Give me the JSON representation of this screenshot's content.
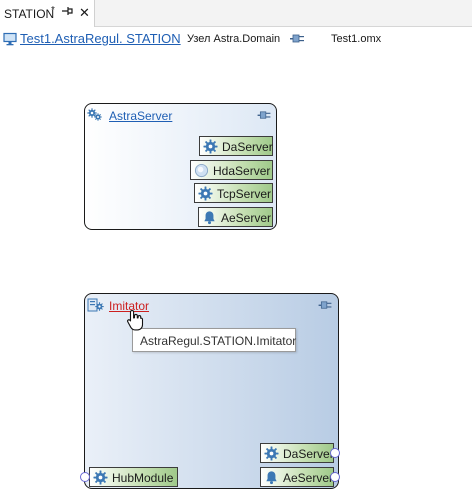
{
  "tab": {
    "title": "STATION",
    "modified": "*",
    "pin_icon": "pin-icon",
    "close_icon": "close-icon"
  },
  "pathbar": {
    "station_icon": "monitor-icon",
    "station_link": "Test1.AstraRegul. STATION",
    "node_text": "Узел Astra.Domain",
    "network_icon": "network-icon",
    "file": "Test1.omx"
  },
  "blocks": [
    {
      "title": "AstraServer",
      "icon": "server-gears-icon",
      "network_icon": "network-icon",
      "ports": [
        {
          "label": "DaServer",
          "icon": "gear-icon"
        },
        {
          "label": "HdaServer",
          "icon": "history-icon"
        },
        {
          "label": "TcpServer",
          "icon": "gear-icon"
        },
        {
          "label": "AeServer",
          "icon": "bell-icon"
        }
      ]
    },
    {
      "title": "Imitator",
      "icon": "imitator-icon",
      "network_icon": "network-icon",
      "ports_right": [
        {
          "label": "DaServer",
          "icon": "gear-icon"
        },
        {
          "label": "AeServer",
          "icon": "bell-icon"
        }
      ],
      "ports_left": [
        {
          "label": "HubModule",
          "icon": "gear-icon"
        }
      ]
    }
  ],
  "tooltip": {
    "text": "AstraRegul.STATION.Imitator"
  },
  "colors": {
    "link": "#1f5fb4",
    "active_link": "#cc1f1f",
    "port_green": "#9fc98a",
    "block_blue": "#b8cce4",
    "connector": "#6a6ad4"
  }
}
